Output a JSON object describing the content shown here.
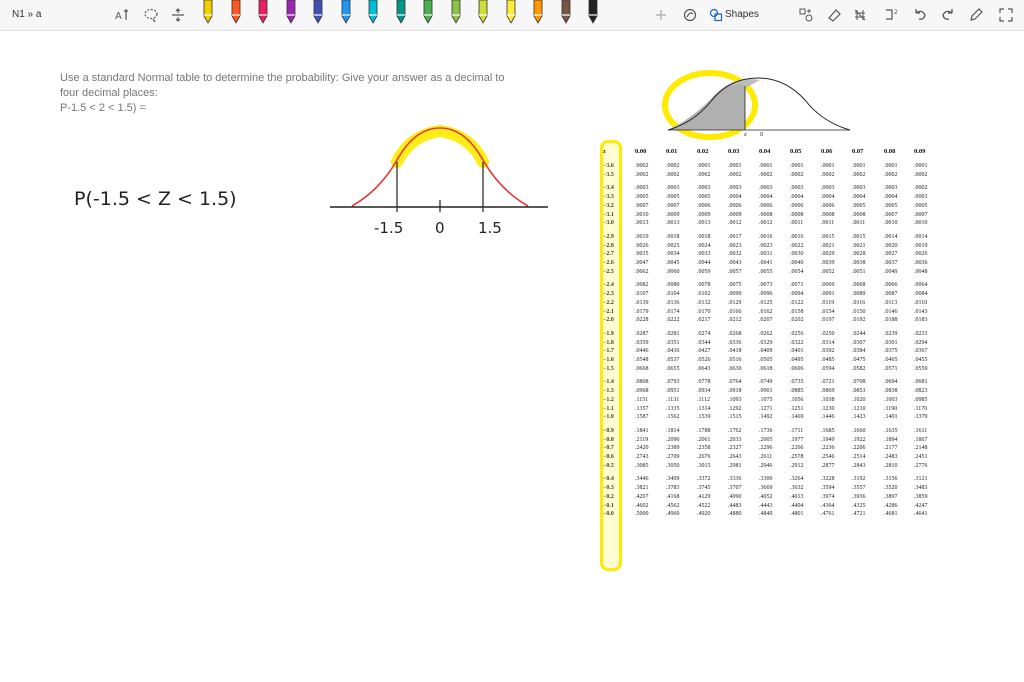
{
  "app": {
    "breadcrumb": "N1 » a"
  },
  "toolbar": {
    "shapes_label": "Shapes",
    "pen_colors": [
      "#f0d000",
      "#ff5722",
      "#e91e63",
      "#9c27b0",
      "#3f51b5",
      "#2196f3",
      "#00bcd4",
      "#009688",
      "#4caf50",
      "#8bc34a",
      "#cddc39",
      "#ffeb3b",
      "#ff9800",
      "#795548",
      "#222222"
    ],
    "icons": [
      "ink-to-text-icon",
      "lasso-icon",
      "add-space-icon",
      "undo-icon",
      "redo-icon",
      "eraser-icon",
      "ruler-icon",
      "grid-icon",
      "settings-icon",
      "fullscreen-icon"
    ]
  },
  "question": {
    "line1": "Use a standard Normal table to determine the probability: Give your answer as a decimal to",
    "line2": "four decimal places:",
    "line3": "P-1.5 < 2 < 1.5) ="
  },
  "handwriting": {
    "expression": "P(-1.5 < Z < 1.5)",
    "axis_labels": [
      "-1.5",
      "0",
      "1.5"
    ]
  },
  "table": {
    "header": [
      "z",
      "0.00",
      "0.01",
      "0.02",
      "0.03",
      "0.04",
      "0.05",
      "0.06",
      "0.07",
      "0.08",
      "0.09"
    ],
    "curve_labels": [
      "z",
      "0"
    ],
    "rows": [
      [
        "−3.6",
        ".0002",
        ".0002",
        ".0001",
        ".0001",
        ".0001",
        ".0001",
        ".0001",
        ".0001",
        ".0001",
        ".0001"
      ],
      [
        "−3.5",
        ".0002",
        ".0002",
        ".0002",
        ".0002",
        ".0002",
        ".0002",
        ".0002",
        ".0002",
        ".0002",
        ".0002"
      ],
      [
        "−3.4",
        ".0003",
        ".0003",
        ".0003",
        ".0003",
        ".0003",
        ".0003",
        ".0003",
        ".0003",
        ".0003",
        ".0002"
      ],
      [
        "−3.3",
        ".0005",
        ".0005",
        ".0005",
        ".0004",
        ".0004",
        ".0004",
        ".0004",
        ".0004",
        ".0004",
        ".0003"
      ],
      [
        "−3.2",
        ".0007",
        ".0007",
        ".0006",
        ".0006",
        ".0006",
        ".0006",
        ".0006",
        ".0005",
        ".0005",
        ".0005"
      ],
      [
        "−3.1",
        ".0010",
        ".0009",
        ".0009",
        ".0009",
        ".0008",
        ".0008",
        ".0008",
        ".0008",
        ".0007",
        ".0007"
      ],
      [
        "−3.0",
        ".0013",
        ".0013",
        ".0013",
        ".0012",
        ".0012",
        ".0011",
        ".0011",
        ".0011",
        ".0010",
        ".0010"
      ],
      [
        "−2.9",
        ".0019",
        ".0018",
        ".0018",
        ".0017",
        ".0016",
        ".0016",
        ".0015",
        ".0015",
        ".0014",
        ".0014"
      ],
      [
        "−2.8",
        ".0026",
        ".0025",
        ".0024",
        ".0023",
        ".0023",
        ".0022",
        ".0021",
        ".0021",
        ".0020",
        ".0019"
      ],
      [
        "−2.7",
        ".0035",
        ".0034",
        ".0033",
        ".0032",
        ".0031",
        ".0030",
        ".0029",
        ".0028",
        ".0027",
        ".0026"
      ],
      [
        "−2.6",
        ".0047",
        ".0045",
        ".0044",
        ".0043",
        ".0041",
        ".0040",
        ".0039",
        ".0038",
        ".0037",
        ".0036"
      ],
      [
        "−2.5",
        ".0062",
        ".0060",
        ".0059",
        ".0057",
        ".0055",
        ".0054",
        ".0052",
        ".0051",
        ".0049",
        ".0048"
      ],
      [
        "−2.4",
        ".0082",
        ".0080",
        ".0078",
        ".0075",
        ".0073",
        ".0071",
        ".0069",
        ".0068",
        ".0066",
        ".0064"
      ],
      [
        "−2.3",
        ".0107",
        ".0104",
        ".0102",
        ".0099",
        ".0096",
        ".0094",
        ".0091",
        ".0089",
        ".0087",
        ".0084"
      ],
      [
        "−2.2",
        ".0139",
        ".0136",
        ".0132",
        ".0129",
        ".0125",
        ".0122",
        ".0119",
        ".0116",
        ".0113",
        ".0110"
      ],
      [
        "−2.1",
        ".0179",
        ".0174",
        ".0170",
        ".0166",
        ".0162",
        ".0158",
        ".0154",
        ".0150",
        ".0146",
        ".0143"
      ],
      [
        "−2.0",
        ".0228",
        ".0222",
        ".0217",
        ".0212",
        ".0207",
        ".0202",
        ".0197",
        ".0192",
        ".0188",
        ".0183"
      ],
      [
        "−1.9",
        ".0287",
        ".0281",
        ".0274",
        ".0268",
        ".0262",
        ".0256",
        ".0250",
        ".0244",
        ".0239",
        ".0233"
      ],
      [
        "−1.8",
        ".0359",
        ".0351",
        ".0344",
        ".0336",
        ".0329",
        ".0322",
        ".0314",
        ".0307",
        ".0301",
        ".0294"
      ],
      [
        "−1.7",
        ".0446",
        ".0436",
        ".0427",
        ".0418",
        ".0409",
        ".0401",
        ".0392",
        ".0384",
        ".0375",
        ".0367"
      ],
      [
        "−1.6",
        ".0548",
        ".0537",
        ".0526",
        ".0516",
        ".0505",
        ".0495",
        ".0485",
        ".0475",
        ".0465",
        ".0455"
      ],
      [
        "−1.5",
        ".0668",
        ".0655",
        ".0643",
        ".0630",
        ".0618",
        ".0606",
        ".0594",
        ".0582",
        ".0571",
        ".0559"
      ],
      [
        "−1.4",
        ".0808",
        ".0793",
        ".0778",
        ".0764",
        ".0749",
        ".0735",
        ".0721",
        ".0708",
        ".0694",
        ".0681"
      ],
      [
        "−1.3",
        ".0968",
        ".0951",
        ".0934",
        ".0918",
        ".0901",
        ".0885",
        ".0869",
        ".0853",
        ".0838",
        ".0823"
      ],
      [
        "−1.2",
        ".1151",
        ".1131",
        ".1112",
        ".1093",
        ".1075",
        ".1056",
        ".1038",
        ".1020",
        ".1003",
        ".0985"
      ],
      [
        "−1.1",
        ".1357",
        ".1335",
        ".1314",
        ".1292",
        ".1271",
        ".1251",
        ".1230",
        ".1210",
        ".1190",
        ".1170"
      ],
      [
        "−1.0",
        ".1587",
        ".1562",
        ".1539",
        ".1515",
        ".1492",
        ".1469",
        ".1446",
        ".1423",
        ".1401",
        ".1379"
      ],
      [
        "−0.9",
        ".1841",
        ".1814",
        ".1788",
        ".1762",
        ".1736",
        ".1711",
        ".1685",
        ".1660",
        ".1635",
        ".1611"
      ],
      [
        "−0.8",
        ".2119",
        ".2090",
        ".2061",
        ".2033",
        ".2005",
        ".1977",
        ".1949",
        ".1922",
        ".1894",
        ".1867"
      ],
      [
        "−0.7",
        ".2420",
        ".2389",
        ".2358",
        ".2327",
        ".2296",
        ".2266",
        ".2236",
        ".2206",
        ".2177",
        ".2148"
      ],
      [
        "−0.6",
        ".2743",
        ".2709",
        ".2676",
        ".2643",
        ".2611",
        ".2578",
        ".2546",
        ".2514",
        ".2483",
        ".2451"
      ],
      [
        "−0.5",
        ".3085",
        ".3050",
        ".3015",
        ".2981",
        ".2946",
        ".2912",
        ".2877",
        ".2843",
        ".2810",
        ".2776"
      ],
      [
        "−0.4",
        ".3446",
        ".3409",
        ".3372",
        ".3336",
        ".3300",
        ".3264",
        ".3228",
        ".3192",
        ".3156",
        ".3121"
      ],
      [
        "−0.3",
        ".3821",
        ".3783",
        ".3745",
        ".3707",
        ".3669",
        ".3632",
        ".3594",
        ".3557",
        ".3520",
        ".3483"
      ],
      [
        "−0.2",
        ".4207",
        ".4168",
        ".4129",
        ".4090",
        ".4052",
        ".4013",
        ".3974",
        ".3936",
        ".3897",
        ".3859"
      ],
      [
        "−0.1",
        ".4602",
        ".4562",
        ".4522",
        ".4483",
        ".4443",
        ".4404",
        ".4364",
        ".4325",
        ".4286",
        ".4247"
      ],
      [
        "−0.0",
        ".5000",
        ".4960",
        ".4920",
        ".4880",
        ".4840",
        ".4801",
        ".4761",
        ".4721",
        ".4681",
        ".4641"
      ]
    ]
  }
}
